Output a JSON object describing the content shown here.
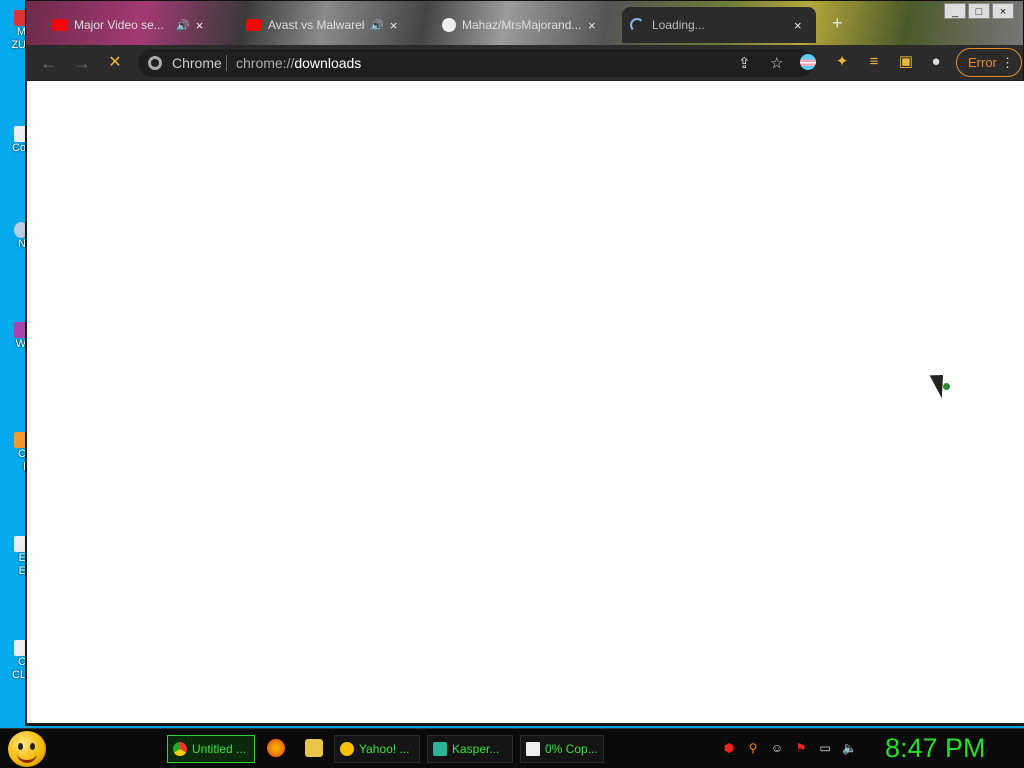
{
  "desktop": {
    "icons": [
      {
        "label": "M\nZU"
      },
      {
        "label": "Co"
      },
      {
        "label": "N"
      },
      {
        "label": "W"
      },
      {
        "label": "C\nI"
      },
      {
        "label": "E\nE"
      },
      {
        "label": "C\nCL"
      }
    ]
  },
  "browser": {
    "tabs": [
      {
        "title": "Major Video se...",
        "favicon": "youtube-icon",
        "extra": "🔊",
        "close": "×"
      },
      {
        "title": "Avast vs Malwareb...",
        "favicon": "youtube-icon",
        "extra": "🔊",
        "close": "×"
      },
      {
        "title": "Mahaz/MrsMajorand...",
        "favicon": "github-icon",
        "extra": "",
        "close": "×"
      },
      {
        "title": "Loading...",
        "favicon": "loading-spinner",
        "extra": "",
        "close": "×",
        "active": true
      }
    ],
    "new_tab": "+",
    "window_controls": {
      "minimize": "_",
      "maximize": "□",
      "close": "×"
    },
    "toolbar": {
      "back": "←",
      "forward": "→",
      "stop": "✕",
      "origin_label": "Chrome",
      "url_prefix": "chrome://",
      "url_path": "downloads",
      "error_label": "Error",
      "menu": "⋮"
    }
  },
  "taskbar": {
    "tasks": [
      {
        "label": "Untitled ...",
        "icon": "chrome-icon"
      },
      {
        "label": "Yahoo! ...",
        "icon": "yahoo-messenger-icon"
      },
      {
        "label": "Kasper...",
        "icon": "kaspersky-icon"
      },
      {
        "label": "0% Cop...",
        "icon": "7zip-icon"
      }
    ],
    "clock": "8:47 PM"
  },
  "colors": {
    "desktop": "#06a9ec",
    "clock": "#28e028",
    "task_text": "#3ee23e",
    "error_accent": "#e38a2e"
  }
}
